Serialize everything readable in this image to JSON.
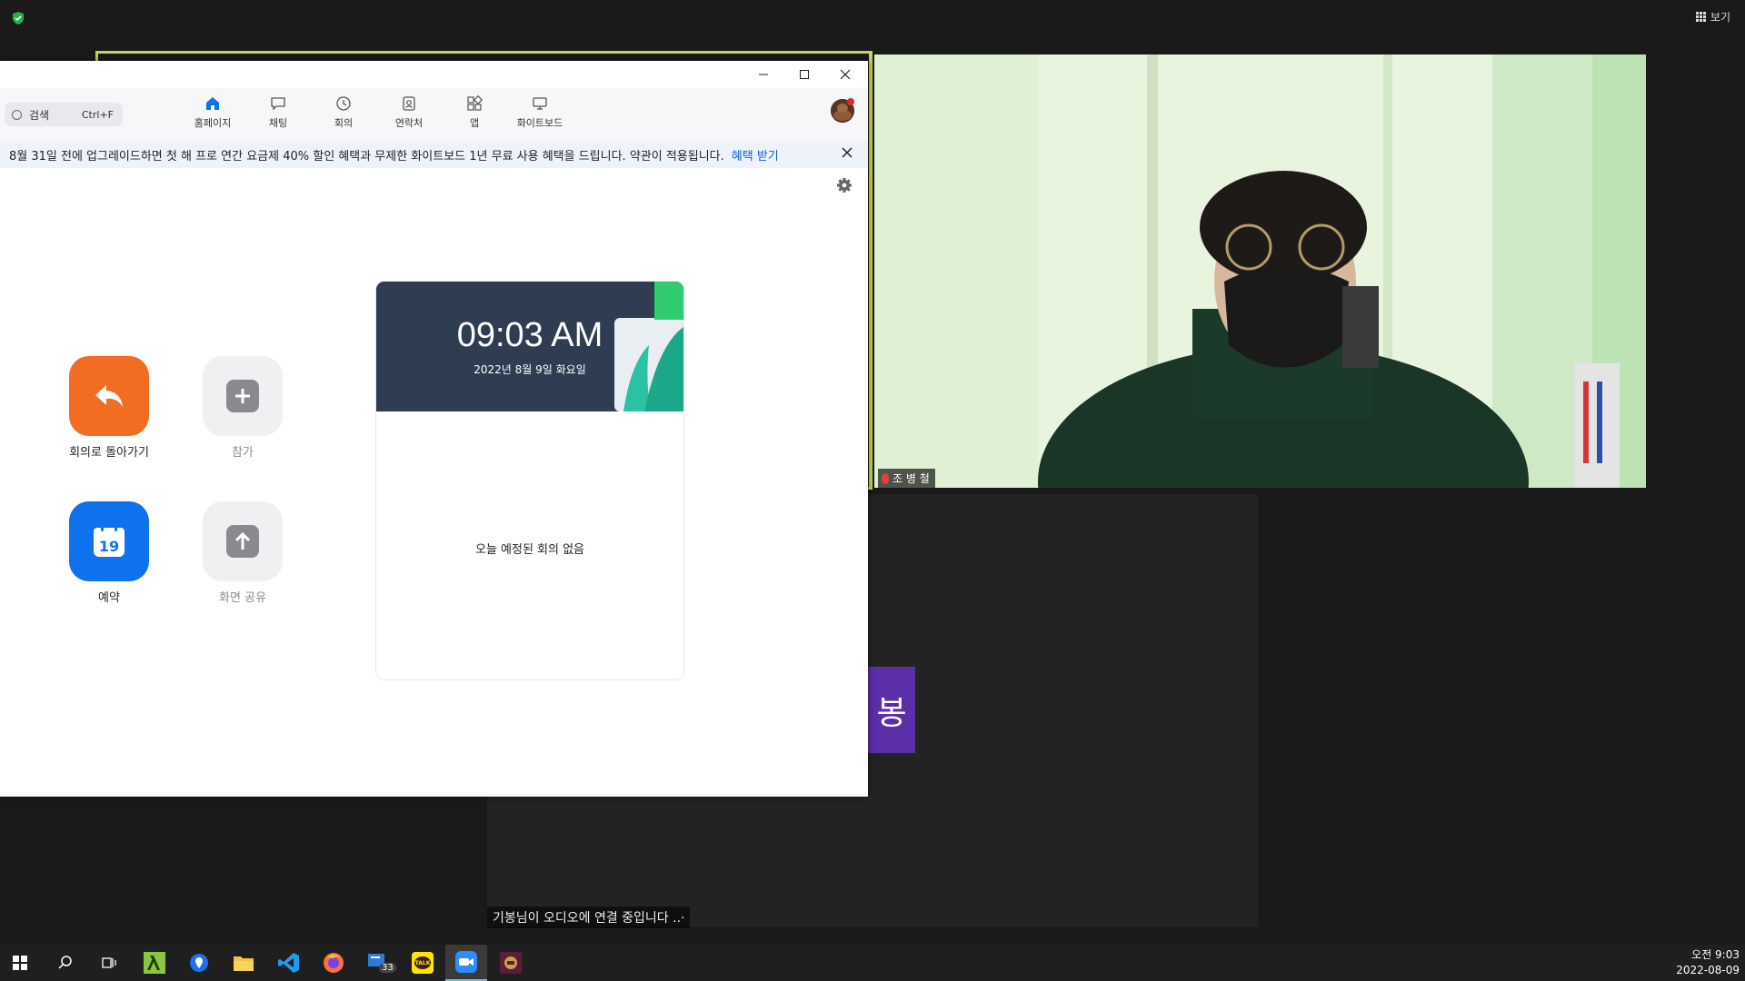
{
  "meeting": {
    "view_label": "보기",
    "participant_name": "조 병 철",
    "name_tile_text": "봉",
    "audio_status": "기봉님이 오디오에 연결 중입니다 ..·"
  },
  "window": {
    "search": {
      "label": "검색",
      "shortcut": "Ctrl+F"
    },
    "tabs": [
      {
        "label": "홈페이지",
        "icon": "home-icon"
      },
      {
        "label": "채팅",
        "icon": "chat-icon"
      },
      {
        "label": "회의",
        "icon": "clock-icon"
      },
      {
        "label": "연락처",
        "icon": "contacts-icon"
      },
      {
        "label": "앱",
        "icon": "apps-icon"
      },
      {
        "label": "화이트보드",
        "icon": "whiteboard-icon"
      }
    ],
    "banner": {
      "text": "8월 31일 전에 업그레이드하면 첫 해 프로 연간 요금제 40% 할인 혜택과 무제한 화이트보드 1년 무료 사용 혜택을 드립니다. 약관이 적용됩니다.",
      "link": "혜택 받기"
    },
    "actions": {
      "return": "회의로 돌아가기",
      "join": "참가",
      "schedule": "예약",
      "schedule_day": "19",
      "share": "화면 공유"
    },
    "card": {
      "time": "09:03 AM",
      "date": "2022년 8월 9일 화요일",
      "empty": "오늘 예정된 회의 없음"
    }
  },
  "taskbar": {
    "badge_count": "33",
    "kakao_label": "TALK",
    "clock_time": "오전 9:03",
    "clock_date": "2022-08-09"
  },
  "colors": {
    "accent_orange": "#f26d21",
    "accent_blue": "#0e72ed",
    "highlight_border": "#c7d35c",
    "name_tile": "#5b2fa8"
  }
}
